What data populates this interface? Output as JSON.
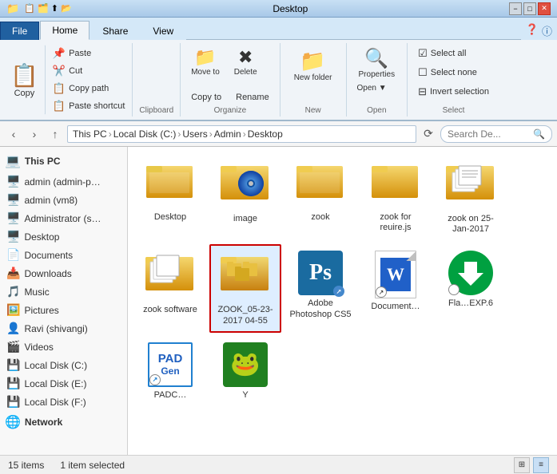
{
  "titleBar": {
    "title": "Desktop",
    "minimizeLabel": "−",
    "maximizeLabel": "□",
    "closeLabel": "✕"
  },
  "ribbonTabs": {
    "file": "File",
    "home": "Home",
    "share": "Share",
    "view": "View"
  },
  "clipboard": {
    "copy": "Copy",
    "paste": "Paste",
    "cut": "Cut",
    "copyPath": "Copy path",
    "pasteShortcut": "Paste shortcut",
    "groupLabel": "Clipboard"
  },
  "organize": {
    "moveTo": "Move to",
    "delete": "Delete",
    "copyTo": "Copy to",
    "rename": "Rename",
    "groupLabel": "Organize"
  },
  "newGroup": {
    "newFolder": "New folder",
    "groupLabel": "New"
  },
  "openGroup": {
    "properties": "Properties",
    "openWith": "Open ▼",
    "groupLabel": "Open"
  },
  "selectGroup": {
    "selectAll": "Select all",
    "selectNone": "Select none",
    "invertSelection": "Invert selection",
    "groupLabel": "Select"
  },
  "addressBar": {
    "back": "‹",
    "forward": "›",
    "up": "↑",
    "refresh": "⟳",
    "pathSegments": [
      "This PC",
      "Local Disk (C:)",
      "Users",
      "Admin",
      "Desktop"
    ],
    "searchPlaceholder": "Search De...",
    "searchIcon": "🔍"
  },
  "sidebar": {
    "thisPC": "This PC",
    "items": [
      {
        "id": "admin-p",
        "label": "admin (admin-p…",
        "icon": "💻"
      },
      {
        "id": "admin-vm8",
        "label": "admin (vm8)",
        "icon": "💻"
      },
      {
        "id": "administrator",
        "label": "Administrator (s…",
        "icon": "💻"
      },
      {
        "id": "desktop",
        "label": "Desktop",
        "icon": "🖥️"
      },
      {
        "id": "documents",
        "label": "Documents",
        "icon": "📄"
      },
      {
        "id": "downloads",
        "label": "Downloads",
        "icon": "📥"
      },
      {
        "id": "music",
        "label": "Music",
        "icon": "🎵"
      },
      {
        "id": "pictures",
        "label": "Pictures",
        "icon": "🖼️"
      },
      {
        "id": "ravi",
        "label": "Ravi (shivangi)",
        "icon": "👤"
      },
      {
        "id": "videos",
        "label": "Videos",
        "icon": "🎬"
      },
      {
        "id": "local-c",
        "label": "Local Disk (C:)",
        "icon": "💾"
      },
      {
        "id": "local-e",
        "label": "Local Disk (E:)",
        "icon": "💾"
      },
      {
        "id": "local-f",
        "label": "Local Disk (F:)",
        "icon": "💾"
      }
    ],
    "network": "Network"
  },
  "fileArea": {
    "items": [
      {
        "id": "desktop-folder",
        "name": "Desktop",
        "type": "folder",
        "hasImage": false,
        "selected": false
      },
      {
        "id": "image-folder",
        "name": "image",
        "type": "folder",
        "hasImage": true,
        "selected": false
      },
      {
        "id": "zook-folder",
        "name": "zook",
        "type": "folder",
        "hasImage": false,
        "selected": false
      },
      {
        "id": "zook-require",
        "name": "zook for reuire.js",
        "type": "folder",
        "hasImage": false,
        "selected": false
      },
      {
        "id": "zook-jan",
        "name": "zook on 25-Jan-2017",
        "type": "folder",
        "hasImage": true,
        "selected": false
      },
      {
        "id": "zook-software",
        "name": "zook software",
        "type": "folder",
        "hasImage": true,
        "selected": false
      },
      {
        "id": "zook-selected",
        "name": "ZOOK_05-23-2017 04-55",
        "type": "folder",
        "hasImage": false,
        "selected": true
      },
      {
        "id": "adobe-ps",
        "name": "Adobe Photoshop CS5",
        "type": "app",
        "appType": "ps",
        "selected": false
      },
      {
        "id": "document-file",
        "name": "Document…",
        "type": "word",
        "selected": false
      },
      {
        "id": "flash-exp",
        "name": "Fla…EXP.6",
        "type": "green-arrow",
        "selected": false
      },
      {
        "id": "pad-gen",
        "name": "PADC…",
        "type": "pad",
        "selected": false
      },
      {
        "id": "creature",
        "name": "Y",
        "type": "creature",
        "selected": false
      }
    ]
  },
  "statusBar": {
    "itemCount": "15 items",
    "selectedCount": "1 item selected"
  }
}
